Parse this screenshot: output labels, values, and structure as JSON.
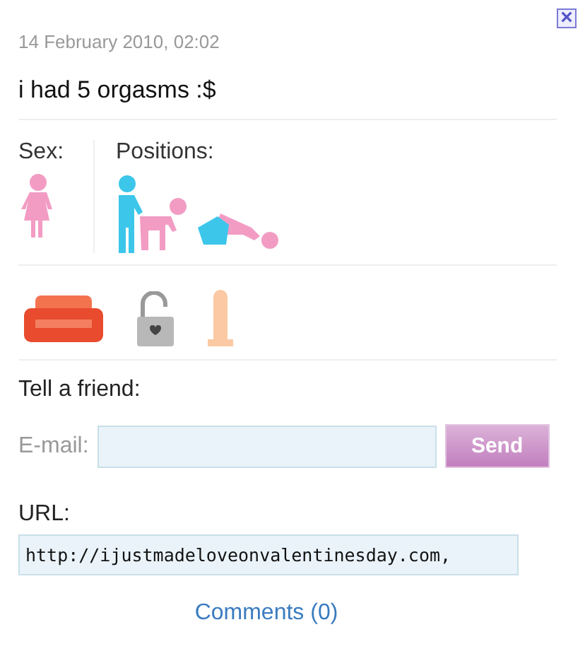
{
  "close_button": {
    "label": "×"
  },
  "post": {
    "date": "14 February 2010, 02:02",
    "title": "i had 5 orgasms :$"
  },
  "details": {
    "sex_label": "Sex:",
    "positions_label": "Positions:"
  },
  "share": {
    "heading": "Tell a friend:",
    "email_label": "E-mail:",
    "send_button": "Send",
    "url_label": "URL:",
    "url_value": "http://ijustmadeloveonvalentinesday.com,"
  },
  "comments_link": "Comments (0)"
}
